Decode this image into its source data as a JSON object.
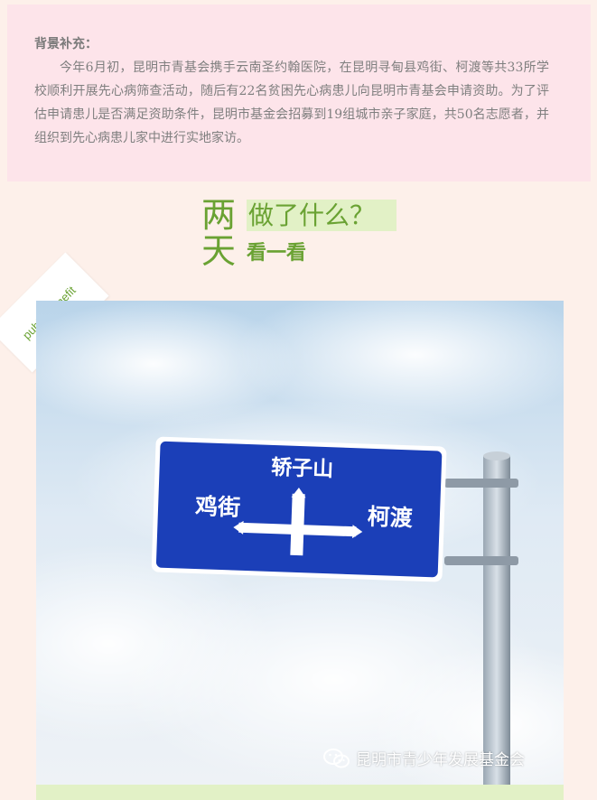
{
  "background": {
    "title": "背景补充：",
    "body": "今年6月初，昆明市青基会携手云南圣约翰医院，在昆明寻甸县鸡街、柯渡等共33所学校顺利开展先心病筛查活动，随后有22名贫困先心病患儿向昆明市青基会申请资助。为了评估申请患儿是否满足资助条件，昆明市基金会招募到19组城市亲子家庭，共50名志愿者，并组织到先心病患儿家中进行实地家访。"
  },
  "heading": {
    "char1": "两",
    "char2": "天",
    "highlight": "做了什么？",
    "sub": "看一看"
  },
  "ribbon": {
    "label": "public benefit"
  },
  "photo": {
    "sign_top": "轿子山",
    "sign_left": "鸡街",
    "sign_right": "柯渡",
    "watermark": "昆明市青少年发展基金会"
  },
  "colors": {
    "accent_green": "#6aa233",
    "highlight_bg": "#e2f1c6",
    "note_bg": "#fde4ea",
    "page_bg": "#fdf0ea",
    "sign_blue": "#1b3fb8"
  }
}
